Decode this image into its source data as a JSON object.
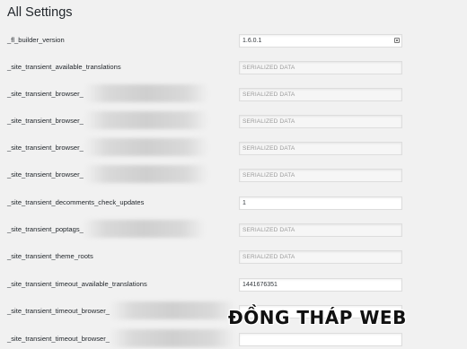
{
  "page": {
    "title": "All Settings"
  },
  "settings": [
    {
      "label": "_fl_builder_version",
      "value": "1.6.0.1",
      "serialized": false,
      "icon": "list-icon"
    },
    {
      "label": "_site_transient_available_translations",
      "value": "SERIALIZED DATA",
      "serialized": true
    },
    {
      "label": "_site_transient_browser_",
      "value": "SERIALIZED DATA",
      "serialized": true,
      "obscured": true
    },
    {
      "label": "_site_transient_browser_",
      "value": "SERIALIZED DATA",
      "serialized": true,
      "obscured": true
    },
    {
      "label": "_site_transient_browser_",
      "value": "SERIALIZED DATA",
      "serialized": true,
      "obscured": true
    },
    {
      "label": "_site_transient_browser_",
      "value": "SERIALIZED DATA",
      "serialized": true,
      "obscured": true
    },
    {
      "label": "_site_transient_decomments_check_updates",
      "value": "1",
      "serialized": false
    },
    {
      "label": "_site_transient_poptags_",
      "value": "SERIALIZED DATA",
      "serialized": true,
      "obscured": true
    },
    {
      "label": "_site_transient_theme_roots",
      "value": "SERIALIZED DATA",
      "serialized": true
    },
    {
      "label": "_site_transient_timeout_available_translations",
      "value": "1441676351",
      "serialized": false
    },
    {
      "label": "_site_transient_timeout_browser_",
      "value": "",
      "serialized": false,
      "obscured": true
    },
    {
      "label": "_site_transient_timeout_browser_",
      "value": "",
      "serialized": false,
      "obscured": true
    }
  ],
  "watermark": {
    "text": "ĐỒNG THÁP WEB"
  }
}
